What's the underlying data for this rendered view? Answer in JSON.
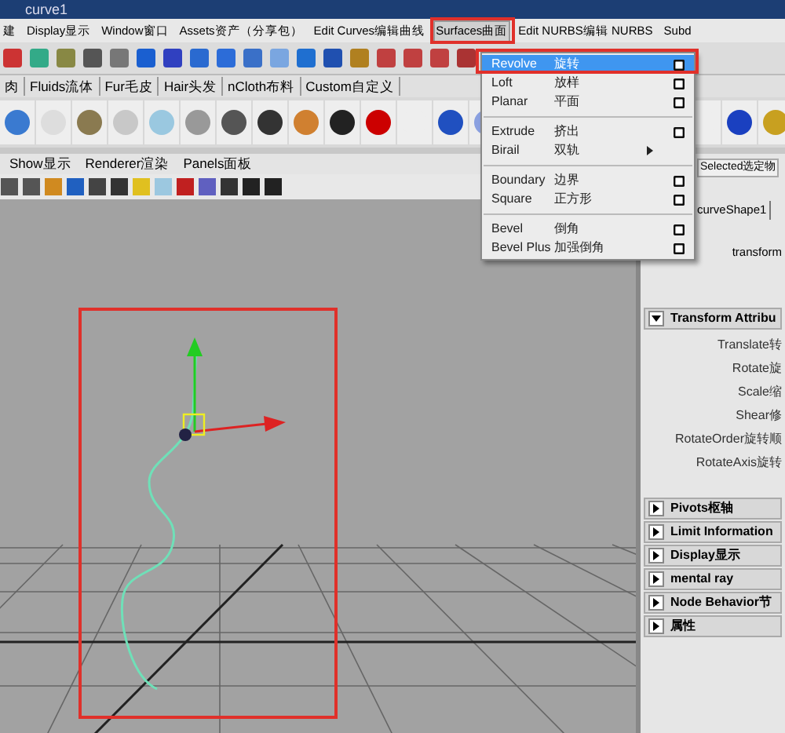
{
  "window": {
    "title": "curve1"
  },
  "menu_bar": [
    {
      "label": "建",
      "selected": false
    },
    {
      "label": "Display显示",
      "selected": false
    },
    {
      "label": "Window窗口",
      "selected": false
    },
    {
      "label": "Assets资产（分享包）",
      "selected": false
    },
    {
      "label": "Edit Curves编辑曲线",
      "selected": false
    },
    {
      "label": "Surfaces曲面",
      "selected": true
    },
    {
      "label": "Edit NURBS编辑 NURBS",
      "selected": false
    },
    {
      "label": "Subd",
      "selected": false
    }
  ],
  "shelf_tabs": [
    {
      "label": "肉",
      "selected": false
    },
    {
      "label": "Fluids流体",
      "selected": false
    },
    {
      "label": "Fur毛皮",
      "selected": false
    },
    {
      "label": "Hair头发",
      "selected": false
    },
    {
      "label": "nCloth布料",
      "selected": false
    },
    {
      "label": "Custom自定义",
      "selected": false
    }
  ],
  "panel_menu": [
    "Show显示",
    "Renderer渲染",
    "Panels面板"
  ],
  "surfaces_menu": [
    {
      "kind": "item",
      "label": "Revolve",
      "label_cn": "旋转",
      "selected": true,
      "option_box": true
    },
    {
      "kind": "item",
      "label": "Loft",
      "label_cn": "放样",
      "selected": false,
      "option_box": true
    },
    {
      "kind": "item",
      "label": "Planar",
      "label_cn": "平面",
      "selected": false,
      "option_box": true
    },
    {
      "kind": "divider"
    },
    {
      "kind": "item",
      "label": "Extrude",
      "label_cn": "挤出",
      "selected": false,
      "option_box": true
    },
    {
      "kind": "submenu",
      "label": "Birail",
      "label_cn": "双轨",
      "selected": false
    },
    {
      "kind": "divider"
    },
    {
      "kind": "item",
      "label": "Boundary",
      "label_cn": "边界",
      "selected": false,
      "option_box": true
    },
    {
      "kind": "item",
      "label": "Square",
      "label_cn": "正方形",
      "selected": false,
      "option_box": true
    },
    {
      "kind": "divider"
    },
    {
      "kind": "item",
      "label": "Bevel",
      "label_cn": "倒角",
      "selected": false,
      "option_box": true
    },
    {
      "kind": "item",
      "label": "Bevel Plus",
      "label_cn": "加强倒角",
      "selected": false,
      "option_box": true
    }
  ],
  "attribute_editor": {
    "header": "Selected选定物",
    "tabs": [
      {
        "label": "curveShape1",
        "selected": false
      }
    ],
    "node_label": "transform",
    "sections": [
      {
        "title": "Transform Attribu",
        "expanded": true,
        "rows": [
          "Translate转",
          "Rotate旋",
          "Scale缩",
          "Shear修",
          "RotateOrder旋转顺",
          "RotateAxis旋转"
        ]
      },
      {
        "title": "Pivots枢轴",
        "expanded": false
      },
      {
        "title": "Limit Information",
        "expanded": false
      },
      {
        "title": "Display显示",
        "expanded": false
      },
      {
        "title": "mental ray",
        "expanded": false
      },
      {
        "title": "Node Behavior节",
        "expanded": false
      },
      {
        "title": "属性",
        "expanded": false
      }
    ]
  }
}
